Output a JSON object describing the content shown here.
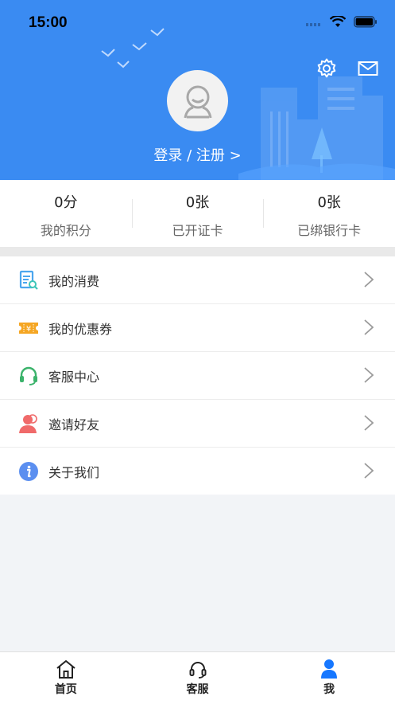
{
  "status_bar": {
    "time": "15:00"
  },
  "header": {
    "login_text": "登录 / 注册 >",
    "bg_color": "#3a8bf2"
  },
  "stats": [
    {
      "value": "0分",
      "label": "我的积分"
    },
    {
      "value": "0张",
      "label": "已开证卡"
    },
    {
      "value": "0张",
      "label": "已绑银行卡"
    }
  ],
  "menu": [
    {
      "label": "我的消费",
      "icon": "receipt-icon"
    },
    {
      "label": "我的优惠券",
      "icon": "coupon-icon"
    },
    {
      "label": "客服中心",
      "icon": "headset-icon"
    },
    {
      "label": "邀请好友",
      "icon": "invite-user-icon"
    },
    {
      "label": "关于我们",
      "icon": "info-icon"
    }
  ],
  "tabbar": [
    {
      "label": "首页",
      "icon": "home-icon"
    },
    {
      "label": "客服",
      "icon": "headset-icon"
    },
    {
      "label": "我",
      "icon": "person-icon",
      "active": true
    }
  ]
}
